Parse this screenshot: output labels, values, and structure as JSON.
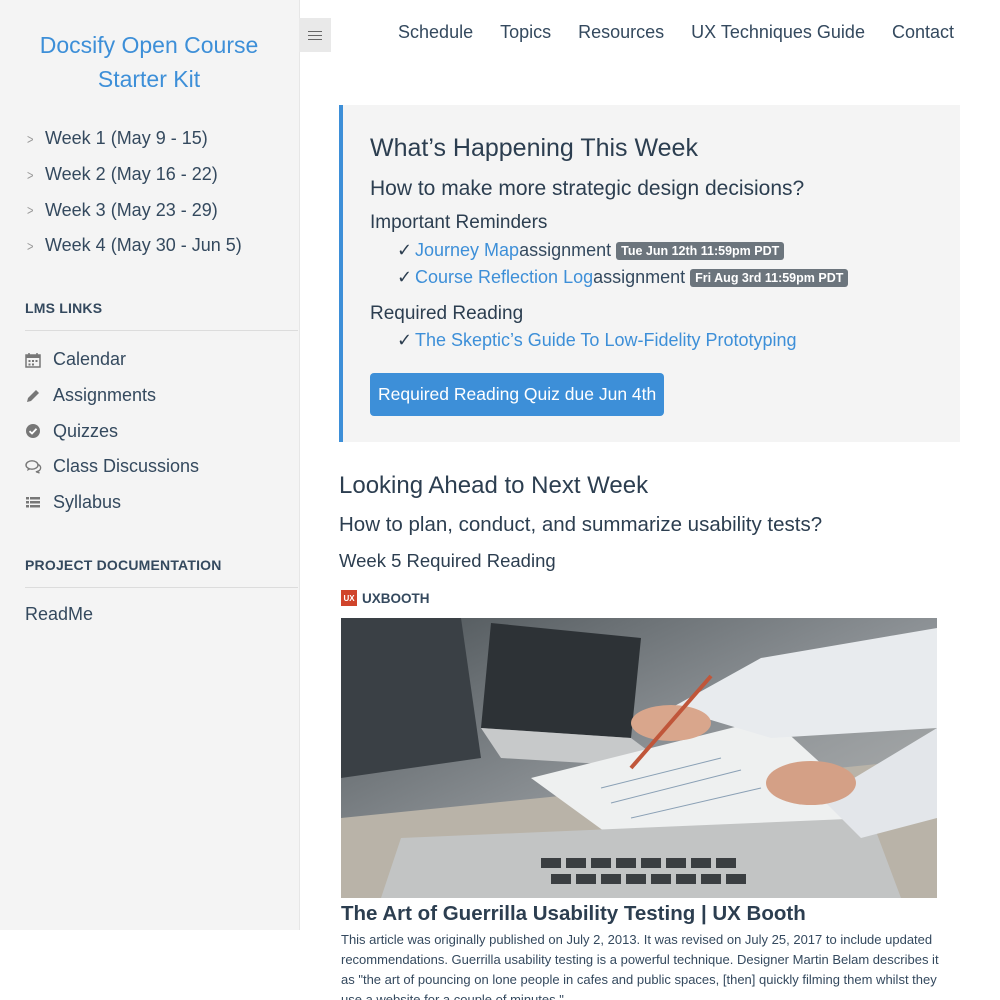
{
  "app": {
    "title_line1": "Docsify Open Course",
    "title_line2": "Starter Kit"
  },
  "sidebar": {
    "weeks": [
      {
        "label": "Week 1 (May 9 - 15)"
      },
      {
        "label": "Week 2 (May 16 - 22)"
      },
      {
        "label": "Week 3 (May 23 - 29)"
      },
      {
        "label": "Week 4 (May 30 - Jun 5)"
      }
    ],
    "lms_heading": "LMS LINKS",
    "lms_links": [
      {
        "label": "Calendar",
        "icon": "calendar-icon"
      },
      {
        "label": "Assignments",
        "icon": "pencil-icon"
      },
      {
        "label": "Quizzes",
        "icon": "check-circle-icon"
      },
      {
        "label": "Class Discussions",
        "icon": "comments-icon"
      },
      {
        "label": "Syllabus",
        "icon": "list-icon"
      }
    ],
    "project_heading": "PROJECT DOCUMENTATION",
    "readme": "ReadMe"
  },
  "nav": {
    "items": [
      "Schedule",
      "Topics",
      "Resources",
      "UX Techniques Guide",
      "Contact"
    ]
  },
  "callout": {
    "title": "What’s Happening This Week",
    "subtitle": "How to make more strategic design decisions?",
    "reminders_heading": "Important Reminders",
    "check": "✓",
    "reminders": [
      {
        "link": "Journey Map",
        "suffix": " assignment",
        "due": "Tue Jun 12th 11:59pm PDT"
      },
      {
        "link": "Course Reflection Log",
        "suffix": " assignment",
        "due": "Fri Aug 3rd 11:59pm PDT"
      }
    ],
    "reading_heading": "Required Reading",
    "reading_link": "The Skeptic’s Guide To Low-Fidelity Prototyping",
    "quiz_button": "Required Reading Quiz due Jun 4th"
  },
  "next_week": {
    "title": "Looking Ahead to Next Week",
    "subtitle": "How to plan, conduct, and summarize usability tests?",
    "reading_heading": "Week 5 Required Reading",
    "card": {
      "site_logo_text": "UX",
      "site_name": "UXBOOTH",
      "article_title": "The Art of Guerrilla Usability Testing | UX Booth",
      "description": "This article was originally published on July 2, 2013. It was revised on July 25, 2017 to include updated recommendations. Guerrilla usability testing is a powerful technique. Designer Martin Belam describes it as \"the art of pouncing on lone people in cafes and public spaces, [then] quickly filming them whilst they use a website for a couple of minutes.\""
    }
  },
  "colors": {
    "accent": "#3d8fd8",
    "badge": "#6c757d",
    "sidebar_bg": "#f4f4f4",
    "callout_bg": "#f4f4f4"
  }
}
